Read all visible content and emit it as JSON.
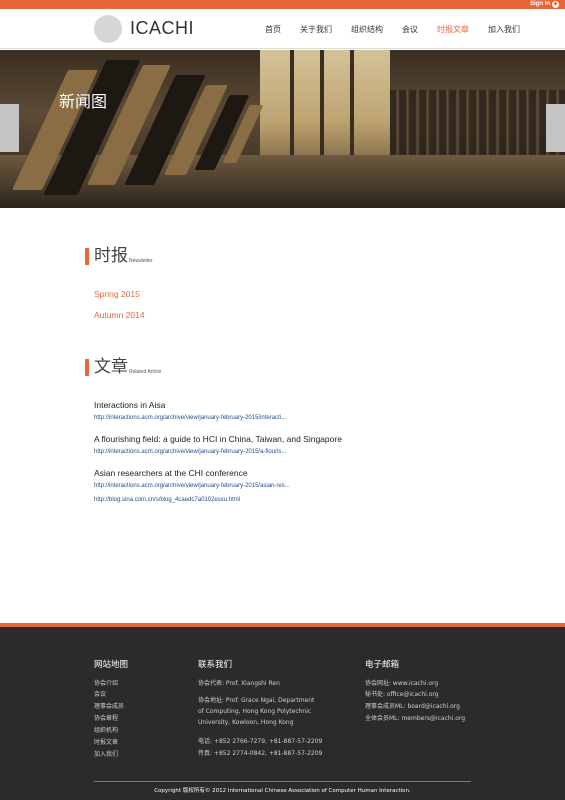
{
  "topbar": {
    "signin_label": "Sign in",
    "signin_icon": "user-icon"
  },
  "header": {
    "logo_text": "ICACHI",
    "nav": [
      {
        "label": "首页"
      },
      {
        "label": "关于我们"
      },
      {
        "label": "组织结构"
      },
      {
        "label": "会议"
      },
      {
        "label": "时报文章",
        "active": true
      },
      {
        "label": "加入我们"
      }
    ]
  },
  "hero": {
    "title": "新闻图"
  },
  "newsletter_section": {
    "title_zh": "时报",
    "title_en": "Newsletter",
    "items": [
      {
        "label": "Spring 2015"
      },
      {
        "label": "Autumn 2014"
      }
    ]
  },
  "articles_section": {
    "title_zh": "文章",
    "title_en": "Related Article",
    "items": [
      {
        "title": "Interactions in Aisa",
        "link": "http://interactions.acm.org/archive/view/january-february-2015/interacti..."
      },
      {
        "title": "A flourishing field: a guide to HCI in China, Taiwan, and Singapore",
        "link": "http://interactions.acm.org/archive/view/january-february-2015/a-flouris..."
      },
      {
        "title": "Asian researchers at the CHI conference",
        "link": "http://interactions.acm.org/archive/view/january-february-2015/asian-res..."
      }
    ],
    "extra_link": "http://blog.sina.com.cn/s/blog_4caedc7a0102esxu.html"
  },
  "footer": {
    "sitemap": {
      "title": "网站地图",
      "items": [
        "协会介绍",
        "会议",
        "理事会成员",
        "协会章程",
        "组织机构",
        "时报文章",
        "加入我们"
      ]
    },
    "contact": {
      "title": "联系我们",
      "rep": "协会代表: Prof. Xiangshi Ren",
      "address_lines": [
        "协会地址: Prof. Grace Ngai, Department",
        "of Computing, Hong Kong Polytechnic",
        "University, Kowloon, Hong Kong"
      ],
      "phone": "电话: +852 2766-7279, +81-887-57-2209",
      "fax": "传真: +852 2774-0842, +81-887-57-2209"
    },
    "email": {
      "title": "电子邮箱",
      "items": [
        "协会网址: www.icachi.org",
        "秘书处: office@icachi.org",
        "理事会成员ML: board@icachi.org",
        "全体会员ML: members@icachi.org"
      ]
    },
    "copyright": "Copyright 版权所有© 2012 International Chinese Association of Computer Human Interaction."
  },
  "colors": {
    "accent": "#e8673a",
    "footer_bg": "#2b2b2b",
    "link": "#1f4e8c"
  }
}
